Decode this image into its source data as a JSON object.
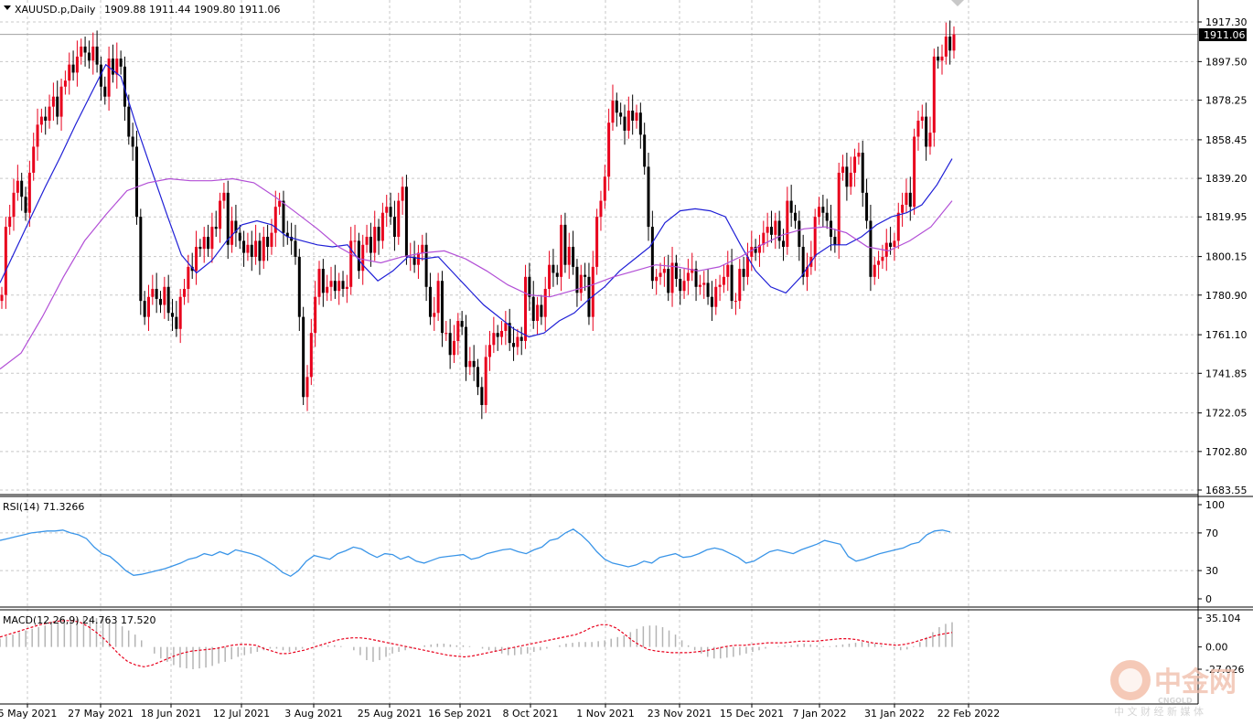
{
  "header": {
    "symbol": "XAUUSD.p,Daily",
    "ohlc": "1909.88 1911.44 1909.80 1911.06"
  },
  "last_price": "1911.06",
  "rsi_label": "RSI(14) 71.3266",
  "macd_label": "MACD(12,26,9) 24.763 17.520",
  "watermark": {
    "name": "中金网",
    "sub": "CNGOLD",
    "tagline": "中 文 财 经 新 媒 体"
  },
  "colors": {
    "background": "#ffffff",
    "grid": "#c8c8c8",
    "bull": "#e8001c",
    "bear": "#000000",
    "ma_fast": "#1f1fd6",
    "ma_slow": "#b24fd6",
    "rsi": "#3a95e8",
    "macd_hist": "#b4b4b4",
    "macd_signal": "#e8001c"
  },
  "chart_data": [
    {
      "type": "candlestick",
      "title": "XAUUSD.p,Daily",
      "ylim": [
        1683.55,
        1927.0
      ],
      "y_ticks": [
        "1917.30",
        "1897.50",
        "1878.25",
        "1858.45",
        "1839.20",
        "1819.95",
        "1800.15",
        "1780.90",
        "1761.10",
        "1741.85",
        "1722.05",
        "1702.80",
        "1683.55"
      ],
      "x_ticks": [
        "5 May 2021",
        "27 May 2021",
        "18 Jun 2021",
        "12 Jul 2021",
        "3 Aug 2021",
        "25 Aug 2021",
        "16 Sep 2021",
        "8 Oct 2021",
        "1 Nov 2021",
        "23 Nov 2021",
        "15 Dec 2021",
        "7 Jan 2022",
        "31 Jan 2022",
        "22 Feb 2022"
      ],
      "grid": true,
      "series": [
        {
          "name": "close",
          "values": [
            1781,
            1815,
            1820,
            1832,
            1838,
            1830,
            1822,
            1842,
            1855,
            1866,
            1870,
            1868,
            1875,
            1880,
            1870,
            1885,
            1888,
            1896,
            1892,
            1900,
            1905,
            1902,
            1898,
            1905,
            1896,
            1885,
            1880,
            1899,
            1891,
            1899,
            1895,
            1875,
            1860,
            1855,
            1820,
            1778,
            1770,
            1780,
            1784,
            1779,
            1776,
            1785,
            1772,
            1770,
            1764,
            1780,
            1784,
            1795,
            1793,
            1805,
            1804,
            1810,
            1804,
            1815,
            1814,
            1828,
            1832,
            1806,
            1818,
            1812,
            1808,
            1802,
            1806,
            1800,
            1808,
            1798,
            1810,
            1805,
            1812,
            1825,
            1828,
            1812,
            1810,
            1808,
            1800,
            1770,
            1730,
            1740,
            1762,
            1780,
            1794,
            1782,
            1785,
            1788,
            1783,
            1788,
            1784,
            1785,
            1808,
            1808,
            1793,
            1806,
            1810,
            1802,
            1815,
            1808,
            1822,
            1825,
            1820,
            1810,
            1828,
            1835,
            1800,
            1800,
            1796,
            1802,
            1806,
            1785,
            1770,
            1772,
            1788,
            1762,
            1762,
            1751,
            1758,
            1768,
            1765,
            1745,
            1748,
            1745,
            1735,
            1726,
            1750,
            1756,
            1762,
            1760,
            1763,
            1767,
            1757,
            1755,
            1760,
            1758,
            1790,
            1780,
            1768,
            1776,
            1770,
            1784,
            1796,
            1792,
            1790,
            1816,
            1796,
            1805,
            1795,
            1782,
            1791,
            1790,
            1770,
            1795,
            1820,
            1828,
            1840,
            1867,
            1878,
            1872,
            1870,
            1863,
            1873,
            1868,
            1872,
            1861,
            1845,
            1815,
            1788,
            1790,
            1792,
            1794,
            1782,
            1797,
            1789,
            1783,
            1788,
            1792,
            1794,
            1785,
            1786,
            1787,
            1780,
            1775,
            1785,
            1786,
            1790,
            1796,
            1778,
            1778,
            1794,
            1790,
            1800,
            1805,
            1802,
            1806,
            1812,
            1815,
            1811,
            1818,
            1808,
            1805,
            1828,
            1822,
            1818,
            1805,
            1790,
            1795,
            1800,
            1820,
            1825,
            1822,
            1818,
            1810,
            1806,
            1842,
            1845,
            1835,
            1842,
            1850,
            1852,
            1832,
            1818,
            1790,
            1796,
            1798,
            1800,
            1807,
            1805,
            1808,
            1822,
            1826,
            1832,
            1825,
            1860,
            1868,
            1870,
            1855,
            1862,
            1900,
            1898,
            1900,
            1910,
            1903,
            1911.06
          ]
        },
        {
          "name": "MA fast",
          "values": [
            1787,
            1803,
            1819,
            1835,
            1850,
            1866,
            1881,
            1896,
            1890,
            1866,
            1844,
            1822,
            1801,
            1792,
            1798,
            1808,
            1816,
            1818,
            1816,
            1810,
            1808,
            1806,
            1805,
            1806,
            1796,
            1788,
            1793,
            1800,
            1799,
            1800,
            1792,
            1784,
            1776,
            1770,
            1764,
            1760,
            1762,
            1768,
            1772,
            1779,
            1785,
            1793,
            1799,
            1805,
            1817,
            1823,
            1824,
            1823,
            1820,
            1806,
            1793,
            1785,
            1782,
            1790,
            1801,
            1806,
            1806,
            1810,
            1816,
            1820,
            1822,
            1826,
            1836,
            1849
          ]
        },
        {
          "name": "MA slow",
          "values": [
            1744,
            1752,
            1770,
            1790,
            1808,
            1821,
            1833,
            1837,
            1839,
            1838,
            1838,
            1839,
            1837,
            1830,
            1822,
            1814,
            1805,
            1799,
            1797,
            1800,
            1802,
            1803,
            1799,
            1793,
            1786,
            1781,
            1780,
            1783,
            1786,
            1790,
            1793,
            1796,
            1795,
            1793,
            1795,
            1800,
            1806,
            1811,
            1814,
            1815,
            1812,
            1805,
            1803,
            1808,
            1815,
            1828
          ]
        }
      ]
    },
    {
      "type": "line",
      "title": "RSI(14) 71.3266",
      "ylim": [
        0,
        100
      ],
      "y_ticks": [
        "100",
        "70",
        "30",
        "0"
      ],
      "series": [
        {
          "name": "RSI(14)",
          "values": [
            62,
            64,
            66,
            68,
            70,
            71,
            72,
            72,
            73,
            70,
            68,
            64,
            55,
            48,
            45,
            38,
            30,
            25,
            26,
            28,
            30,
            32,
            35,
            38,
            42,
            44,
            48,
            46,
            50,
            47,
            52,
            50,
            48,
            45,
            40,
            35,
            28,
            24,
            30,
            40,
            46,
            44,
            42,
            48,
            51,
            55,
            53,
            48,
            44,
            48,
            47,
            42,
            45,
            40,
            38,
            41,
            44,
            45,
            46,
            47,
            42,
            44,
            48,
            50,
            52,
            53,
            50,
            48,
            52,
            55,
            62,
            64,
            70,
            74,
            68,
            60,
            50,
            42,
            38,
            36,
            34,
            36,
            40,
            38,
            44,
            46,
            48,
            44,
            45,
            48,
            52,
            54,
            52,
            48,
            44,
            38,
            40,
            45,
            50,
            52,
            50,
            48,
            52,
            55,
            58,
            62,
            60,
            58,
            45,
            40,
            42,
            45,
            48,
            50,
            52,
            54,
            58,
            60,
            68,
            72,
            73,
            71
          ]
        }
      ]
    },
    {
      "type": "bar",
      "title": "MACD(12,26,9) 24.763 17.520",
      "ylim": [
        -27.026,
        35.104
      ],
      "y_ticks": [
        "35.104",
        "0.00",
        "-27.026"
      ],
      "series": [
        {
          "name": "MACD histogram",
          "values": [
            10,
            13,
            15,
            18,
            20,
            22,
            24,
            26,
            28,
            30,
            32,
            33,
            34,
            35,
            35,
            35,
            34,
            33,
            30,
            25,
            20,
            15,
            8,
            0,
            -8,
            -14,
            -18,
            -22,
            -25,
            -26,
            -27,
            -26,
            -25,
            -23,
            -20,
            -18,
            -15,
            -12,
            -10,
            -8,
            -6,
            -4,
            -2,
            -2,
            -4,
            -6,
            -4,
            -2,
            0,
            1,
            1,
            2,
            2,
            1,
            0,
            -4,
            -10,
            -16,
            -18,
            -16,
            -12,
            -8,
            -6,
            -4,
            -2,
            0,
            2,
            3,
            4,
            4,
            3,
            2,
            2,
            1,
            0,
            -2,
            -4,
            -6,
            -8,
            -10,
            -10,
            -9,
            -8,
            -6,
            -4,
            -2,
            0,
            2,
            4,
            5,
            6,
            6,
            6,
            7,
            8,
            10,
            12,
            14,
            18,
            22,
            25,
            26,
            26,
            24,
            20,
            15,
            8,
            2,
            -4,
            -8,
            -12,
            -14,
            -14,
            -13,
            -12,
            -10,
            -8,
            -6,
            -4,
            -2,
            0,
            1,
            2,
            2,
            3,
            4,
            3,
            2,
            1,
            1,
            2,
            3,
            4,
            5,
            6,
            5,
            4,
            2,
            0,
            -2,
            -4,
            -3,
            1,
            6,
            12,
            18,
            24,
            28,
            30
          ]
        },
        {
          "name": "MACD signal",
          "values": [
            12,
            15,
            18,
            21,
            24,
            27,
            29,
            31,
            32,
            32,
            30,
            25,
            18,
            10,
            0,
            -10,
            -18,
            -22,
            -24,
            -22,
            -18,
            -14,
            -10,
            -7,
            -5,
            -4,
            -3,
            -2,
            0,
            2,
            3,
            3,
            2,
            -2,
            -5,
            -8,
            -8,
            -6,
            -4,
            -1,
            2,
            5,
            8,
            10,
            11,
            11,
            10,
            8,
            6,
            4,
            2,
            0,
            -2,
            -4,
            -6,
            -8,
            -10,
            -11,
            -12,
            -11,
            -9,
            -7,
            -5,
            -3,
            -1,
            1,
            3,
            5,
            7,
            9,
            11,
            13,
            15,
            19,
            24,
            27,
            27,
            23,
            16,
            8,
            2,
            -3,
            -5,
            -6,
            -7,
            -7,
            -7,
            -6,
            -5,
            -3,
            -1,
            1,
            2,
            2,
            3,
            4,
            5,
            5,
            5,
            6,
            7,
            7,
            7,
            8,
            9,
            10,
            10,
            9,
            7,
            5,
            4,
            3,
            2,
            3,
            5,
            8,
            11,
            14,
            16,
            17.52
          ]
        }
      ]
    }
  ]
}
